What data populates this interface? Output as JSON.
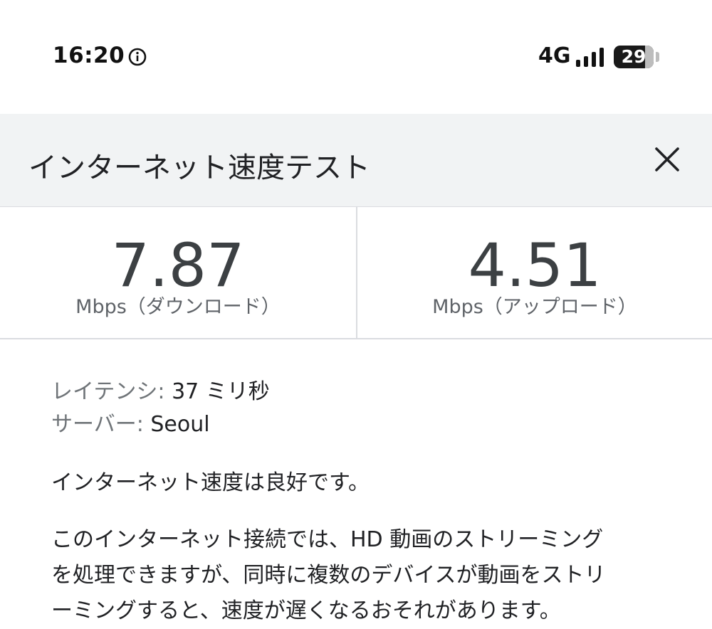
{
  "status_bar": {
    "time": "16:20",
    "network": "4G",
    "battery_level": "29",
    "battery_fraction": 0.29,
    "icons": [
      "info-icon",
      "signal-icon",
      "battery-icon"
    ]
  },
  "dialog": {
    "title": "インターネット速度テスト",
    "close_icon": "close-icon"
  },
  "speed": {
    "download_value": "7.87",
    "download_unit": "Mbps（ダウンロード）",
    "upload_value": "4.51",
    "upload_unit": "Mbps（アップロード）"
  },
  "details": {
    "latency_label": "レイテンシ:",
    "latency_value": "37 ミリ秒",
    "server_label": "サーバー:",
    "server_value": "Seoul"
  },
  "summary": "インターネット速度は良好です。",
  "description_lines": [
    "このインターネット接続では、HD 動画のストリーミング",
    "を処理できますが、同時に複数のデバイスが動画をストリ",
    "ーミングすると、速度が遅くなるおそれがあります。"
  ],
  "colors": {
    "header_bg": "#f1f3f4",
    "divider": "#dadce0",
    "speed_text": "#3c4043",
    "label_grey": "#6f7478"
  }
}
